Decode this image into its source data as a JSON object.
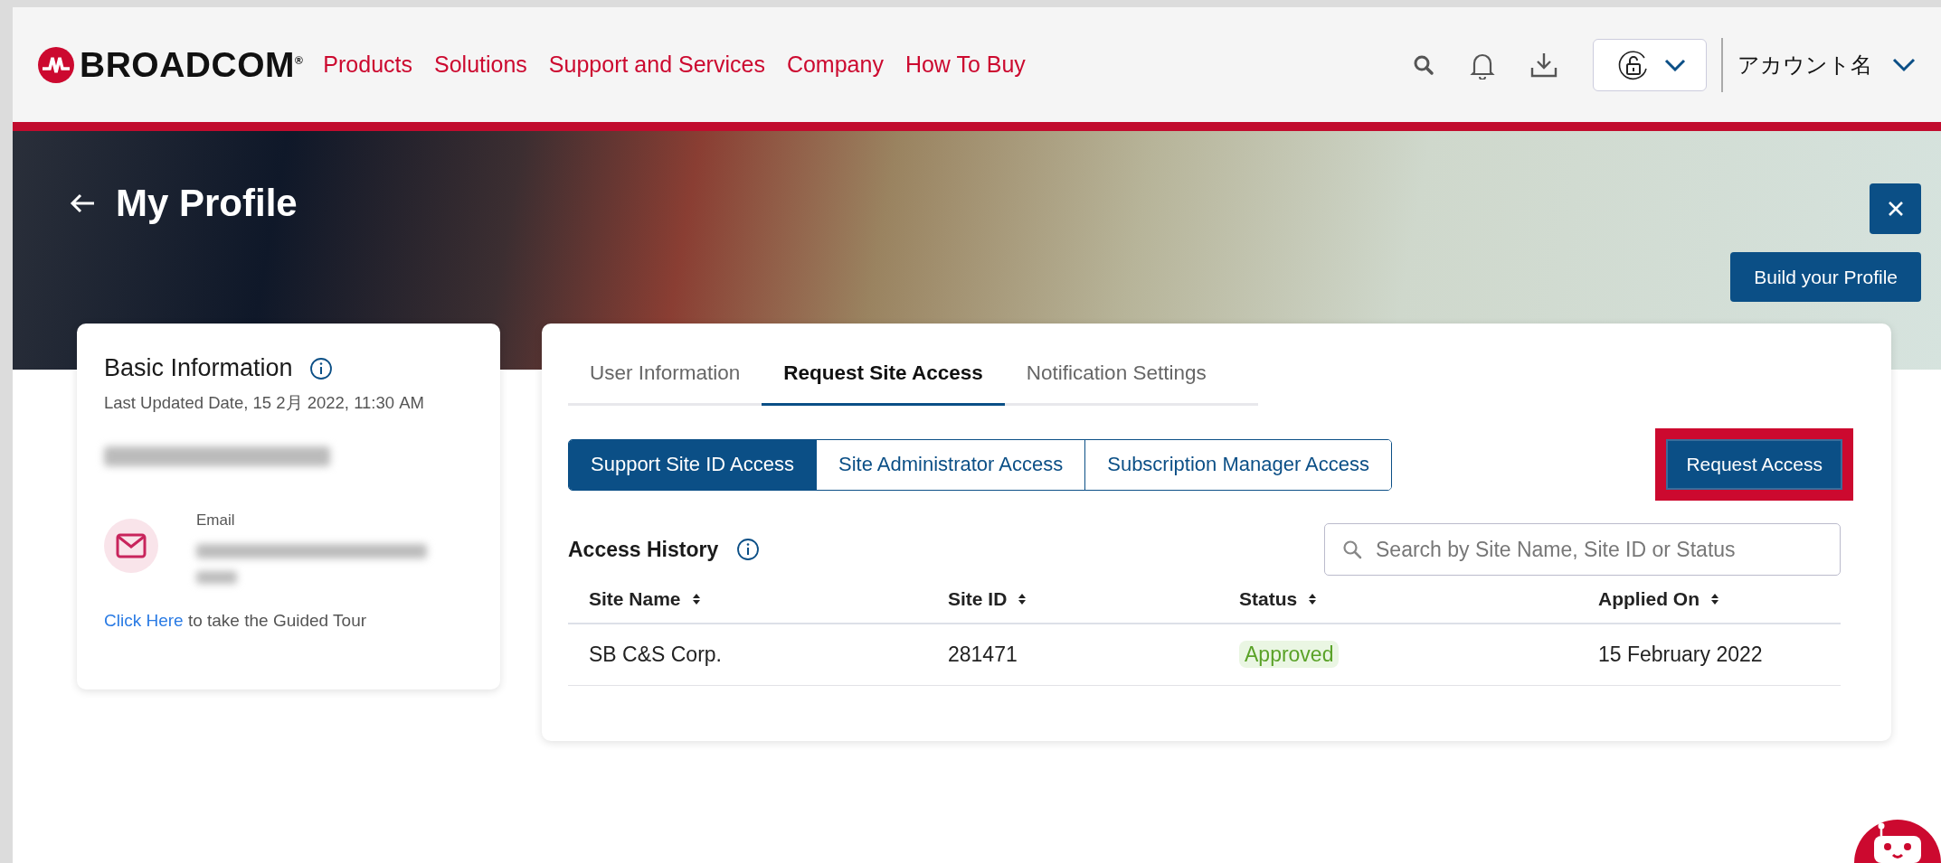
{
  "header": {
    "logo": "BROADCOM$^{®}$",
    "nav": [
      "Products",
      "Solutions",
      "Support and Services",
      "Company",
      "How To Buy"
    ],
    "account": "アカウント名"
  },
  "hero": {
    "title": "My Profile",
    "build_button": "Build your Profile"
  },
  "basic_info": {
    "title": "Basic Information",
    "last_updated": "Last Updated Date, 15 2月 2022, 11:30 AM",
    "name_redacted": true,
    "email_label": "Email",
    "email_redacted": true,
    "tour_link": "Click Here",
    "tour_text": "to take the Guided Tour"
  },
  "tabs": [
    {
      "label": "User Information",
      "selected": false
    },
    {
      "label": "Request Site Access",
      "selected": true
    },
    {
      "label": "Notification Settings",
      "selected": false
    }
  ],
  "access_types": [
    {
      "label": "Support Site ID Access",
      "selected": true
    },
    {
      "label": "Site Administrator Access",
      "selected": false
    },
    {
      "label": "Subscription Manager Access",
      "selected": false
    }
  ],
  "request_button": {
    "label": "Request Access",
    "highlighted": true
  },
  "access_history": {
    "title": "Access History"
  },
  "search": {
    "placeholder": "Search by Site Name, Site ID or Status"
  },
  "table": {
    "columns": [
      "Site Name",
      "Site ID",
      "Status",
      "Applied On"
    ],
    "rows": [
      {
        "site_name": "SB C&S Corp.",
        "site_id": "281471",
        "status": {
          "text": "Approved",
          "kind": "approved"
        },
        "applied_on": "15 February 2022"
      }
    ]
  }
}
